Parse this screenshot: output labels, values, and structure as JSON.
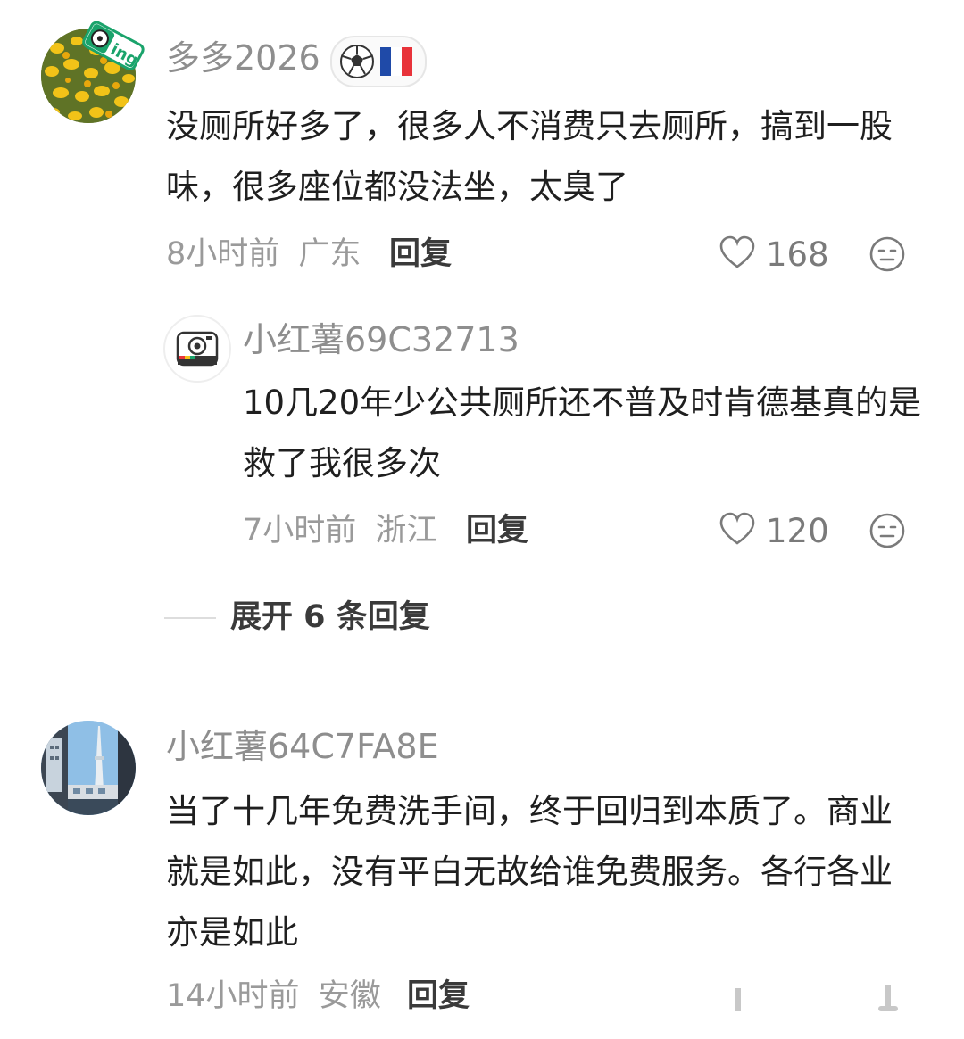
{
  "comments": [
    {
      "username": "多多2026",
      "badge_ing": "ing",
      "content": "没厕所好多了，很多人不消费只去厕所，搞到一股味，很多座位都没法坐，太臭了",
      "time": "8小时前",
      "location": "广东",
      "reply_label": "回复",
      "likes": "168",
      "avatar_icon": "yellow-flowers-avatar",
      "badge_icons": [
        "soccer-ball-icon",
        "france-flag-icon"
      ]
    },
    {
      "username": "小红薯69C32713",
      "content": "10几20年少公共厕所还不普及时肯德基真的是救了我很多次",
      "time": "7小时前",
      "location": "浙江",
      "reply_label": "回复",
      "likes": "120",
      "avatar_icon": "camera-avatar-icon"
    },
    {
      "username": "小红薯64C7FA8E",
      "content": "当了十几年免费洗手间，终于回归到本质了。商业就是如此，没有平白无故给谁免费服务。各行各业亦是如此",
      "time": "14小时前",
      "location": "安徽",
      "reply_label": "回复",
      "avatar_icon": "tower-photo-avatar"
    }
  ],
  "expand_replies": "展开 6 条回复",
  "colors": {
    "accent_green": "#1aa36b",
    "muted": "#9a9a9a"
  }
}
